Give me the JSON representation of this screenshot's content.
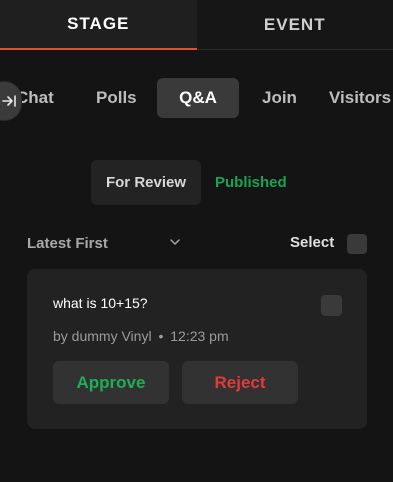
{
  "top_tabs": {
    "stage": "STAGE",
    "event": "EVENT"
  },
  "subnav": {
    "chat": "Chat",
    "polls": "Polls",
    "qa": "Q&A",
    "join": "Join",
    "visitors": "Visitors"
  },
  "review": {
    "for_review": "For Review",
    "published": "Published"
  },
  "controls": {
    "sort_label": "Latest First",
    "select_label": "Select"
  },
  "question": {
    "text": "what is 10+15?",
    "author": "by dummy Vinyl",
    "separator": "•",
    "time": "12:23 pm",
    "approve_label": "Approve",
    "reject_label": "Reject"
  },
  "colors": {
    "accent": "#e0512f",
    "published": "#18a453",
    "approve": "#1fad57",
    "reject": "#e23a3a"
  },
  "icons": {
    "collapse": "collapse-panel-icon",
    "sort": "chevron-down-icon"
  }
}
